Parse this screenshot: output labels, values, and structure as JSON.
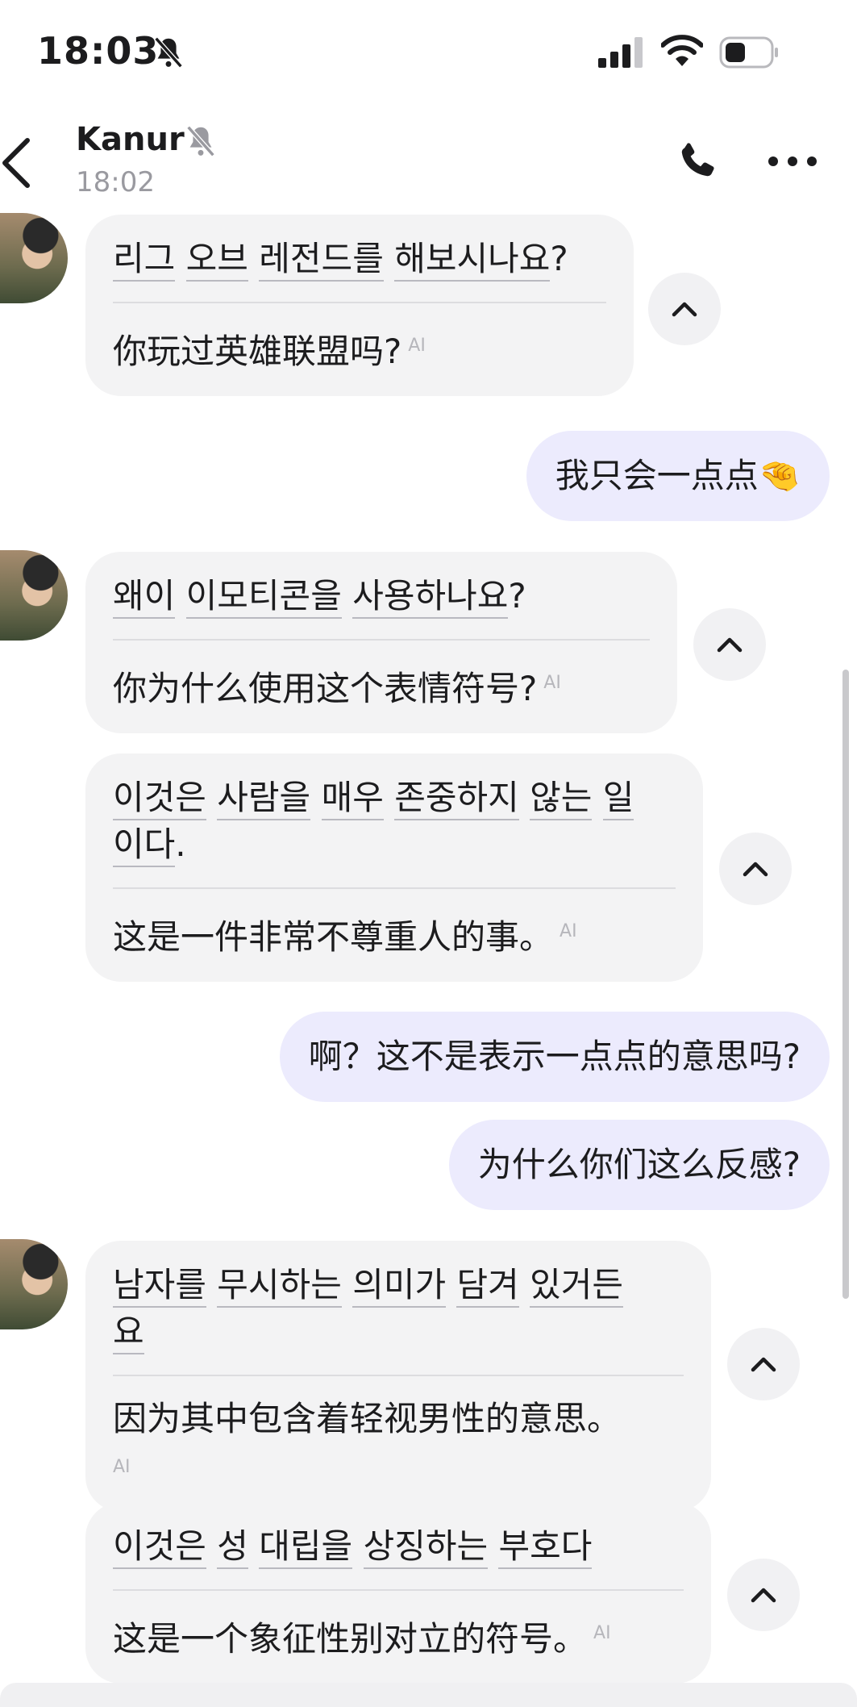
{
  "status_bar": {
    "time": "18:03"
  },
  "header": {
    "name": "Kanur",
    "last_seen": "18:02"
  },
  "ai_tag": "AI",
  "messages": [
    {
      "ko_words": [
        "리그",
        "오브",
        "레전드를",
        "해보시나요"
      ],
      "ko_tail": "?",
      "zh": "你玩过英雄联盟吗?"
    },
    {
      "text": "我只会一点点🤏"
    },
    {
      "ko_words": [
        "왜이",
        "이모티콘을",
        "사용하나요"
      ],
      "ko_tail": "?",
      "zh": "你为什么使用这个表情符号?"
    },
    {
      "ko_words": [
        "이것은",
        "사람을",
        "매우",
        "존중하지",
        "않는",
        "일",
        "이다"
      ],
      "ko_tail": ".",
      "zh": "这是一件非常不尊重人的事。"
    },
    {
      "text": "啊？这不是表示一点点的意思吗?"
    },
    {
      "text": "为什么你们这么反感?"
    },
    {
      "ko_words": [
        "남자를",
        "무시하는",
        "의미가",
        "담겨",
        "있거든",
        "요"
      ],
      "zh": "因为其中包含着轻视男性的意思。"
    },
    {
      "ko_words": [
        "이것은",
        "성",
        "대립을",
        "상징하는",
        "부호다"
      ],
      "zh": "这是一个象征性别对立的符号。"
    }
  ]
}
